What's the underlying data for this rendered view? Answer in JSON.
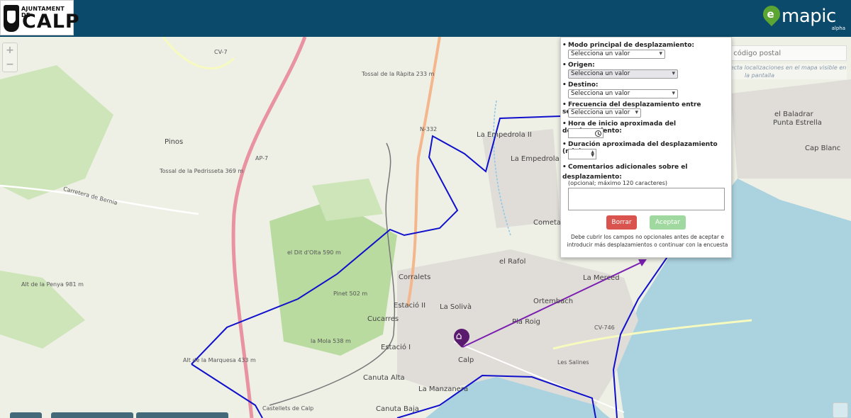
{
  "header": {
    "logo": {
      "top_text": "AJUNTAMENT DE",
      "main_text": "CALP"
    },
    "brand": {
      "name": "mapic",
      "sub": "alpha"
    }
  },
  "map": {
    "zoom_in": "+",
    "zoom_out": "−",
    "search": {
      "placeholder": "Dirección o código postal",
      "hint": "El buscador sólo detecta localizaciones en el mapa visible en la pantalla"
    },
    "labels": [
      "Tossal de la Ràpita 233 m",
      "Pinos",
      "Tossal de la Pedrisseta 369 m",
      "Carretera de Bernia",
      "el Dit d'Olta 590 m",
      "Pinet 502 m",
      "la Mola 538 m",
      "Alt de la Penya 981 m",
      "Alt de la Marquesa 433 m",
      "Corralets",
      "Estació II",
      "La Solivà",
      "Cucarres",
      "Estació I",
      "Calp",
      "Canuta Alta",
      "Canuta Baja",
      "La Manzanera",
      "Pla Roig",
      "Ortembach",
      "La Merced",
      "el Rafol",
      "La Empedrola II",
      "La Empedrola",
      "Cometa",
      "el Baladrar",
      "Punta Estrella",
      "Cap Blanc",
      "Les Salines",
      "Castellets de Calp",
      "CV-7",
      "AP-7",
      "N-332",
      "CV-746"
    ]
  },
  "form": {
    "questions": [
      {
        "label": "Modo principal de desplazamiento:",
        "value": "Selecciona un valor"
      },
      {
        "label": "Origen:",
        "value": "Selecciona un valor"
      },
      {
        "label": "Destino:",
        "value": "Selecciona un valor"
      },
      {
        "label": "Frecuencia del desplazamiento entre semana:",
        "value": "Selecciona un valor"
      },
      {
        "label": "Hora de inicio aproximada del desplazamiento:",
        "value": ""
      },
      {
        "label": "Duración aproximada del desplazamiento (min):",
        "value": ""
      },
      {
        "label": "Comentarios adicionales sobre el desplazamiento:",
        "value": ""
      }
    ],
    "optional_note": "(opcional; máximo 120 caracteres)",
    "borrar": "Borrar",
    "aceptar": "Aceptar",
    "footer_note": "Debe cubrir los campos no opcionales antes de aceptar e introducir más desplazamientos o continuar con la encuesta"
  },
  "colors": {
    "header_bg": "#0b4a6b",
    "route": "#1010cc",
    "arrow": "#7a1fb0",
    "sea": "#aad3df",
    "borrar": "#d9534f",
    "aceptar": "#9fd99f",
    "brand_green": "#5ba532"
  }
}
